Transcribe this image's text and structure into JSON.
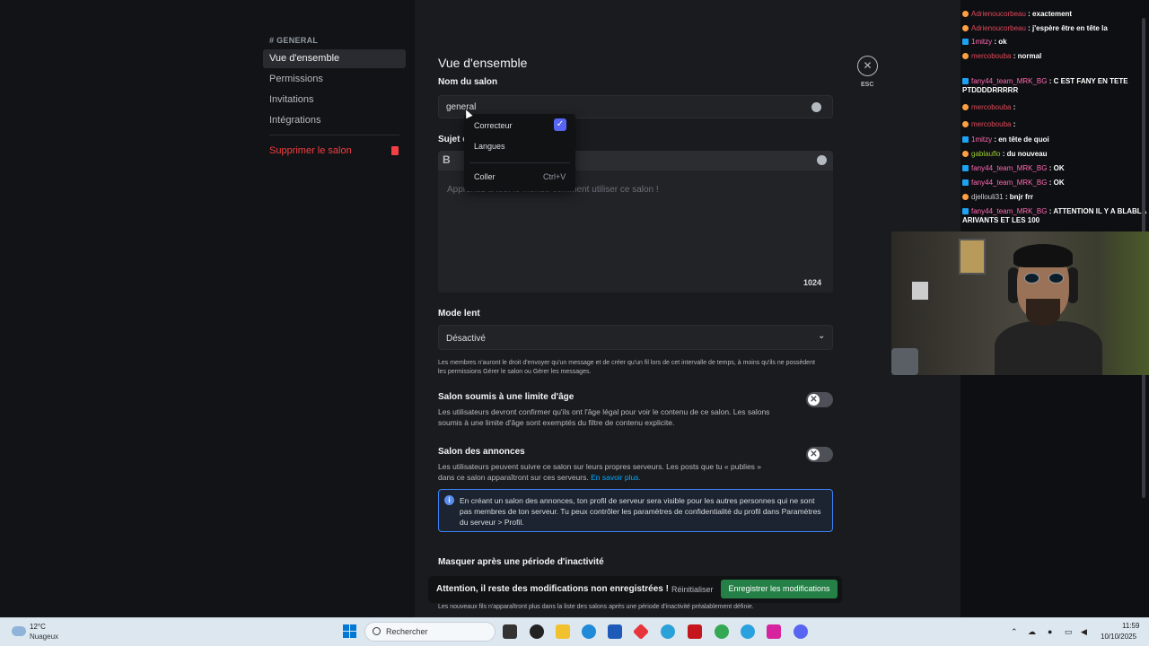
{
  "sidebar": {
    "category": "# GENERAL",
    "items": [
      {
        "label": "Vue d'ensemble"
      },
      {
        "label": "Permissions"
      },
      {
        "label": "Invitations"
      },
      {
        "label": "Intégrations"
      }
    ],
    "delete_label": "Supprimer le salon"
  },
  "main": {
    "title": "Vue d'ensemble",
    "channel_name_label": "Nom du salon",
    "channel_name_value": "general",
    "topic_label": "Sujet d",
    "topic_placeholder": "Apprenez à tout le monde comment utiliser ce salon !",
    "topic_counter": "1024",
    "slowmode_label": "Mode lent",
    "slowmode_value": "Désactivé",
    "slowmode_help": "Les membres n'auront le droit d'envoyer qu'un message et de créer qu'un fil lors de cet intervalle de temps, à moins qu'ils ne possèdent les permissions Gérer le salon ou Gérer les messages.",
    "age_title": "Salon soumis à une limite d'âge",
    "age_desc": "Les utilisateurs devront confirmer qu'ils ont l'âge légal pour voir le contenu de ce salon. Les salons soumis à une limite d'âge sont exemptés du filtre de contenu explicite.",
    "announce_title": "Salon des annonces",
    "announce_desc": "Les utilisateurs peuvent suivre ce salon sur leurs propres serveurs. Les posts que tu « publies » dans ce salon apparaîtront sur ces serveurs.",
    "announce_link": "En savoir plus.",
    "info_text": "En créant un salon des annonces, ton profil de serveur sera visible pour les autres personnes qui ne sont pas membres de ton serveur. Tu peux contrôler les paramètres de confidentialité du profil dans Paramètres du serveur > Profil.",
    "inactivity_title": "Masquer après une période d'inactivité",
    "footer_help": "Les nouveaux fils n'apparaîtront plus dans la liste des salons après une période d'inactivité préalablement définie.",
    "close_label": "ESC"
  },
  "context_menu": {
    "items": [
      "Correcteur",
      "Langues",
      "Coller"
    ],
    "paste_shortcut": "Ctrl+V"
  },
  "notice": {
    "text": "Attention, il reste des modifications non enregistrées !",
    "reset": "Réinitialiser",
    "save": "Enregistrer les modifications"
  },
  "chat": [
    {
      "user": "Adrienoucorbeau",
      "msg": ": exactement",
      "ucls": "u-red"
    },
    {
      "user": "Adrienoucorbeau",
      "msg": ": j'espère être en tête la",
      "ucls": "u-red"
    },
    {
      "user": "1mitzy",
      "msg": ": ok",
      "ucls": "u-pink"
    },
    {
      "user": "mercobouba",
      "msg": ": normal",
      "ucls": "u-red"
    },
    {
      "user": "fany44_team_MRK_BG",
      "msg": ": C EST FANY EN TETE PTDDDDRRRRR",
      "ucls": "u-pink"
    },
    {
      "user": "mercobouba",
      "msg": ":",
      "ucls": "u-red"
    },
    {
      "user": "mercobouba",
      "msg": ":",
      "ucls": "u-red"
    },
    {
      "user": "1mitzy",
      "msg": ": en tête de quoi",
      "ucls": "u-pink"
    },
    {
      "user": "gablauflo",
      "msg": ": du nouveau",
      "ucls": "u-green"
    },
    {
      "user": "fany44_team_MRK_BG",
      "msg": ": OK",
      "ucls": "u-pink"
    },
    {
      "user": "fany44_team_MRK_BG",
      "msg": ": OK",
      "ucls": "u-pink"
    },
    {
      "user": "djellouli31",
      "msg": ": bnjr frr",
      "ucls": "u-grey"
    },
    {
      "user": "fany44_team_MRK_BG",
      "msg": ": ATTENTION IL Y A BLABLA ARIVANTS ET LES 100",
      "ucls": "u-pink"
    }
  ],
  "taskbar": {
    "temp": "12°C",
    "weather": "Nuageux",
    "search": "Rechercher",
    "time": "11:59",
    "date": "10/10/2025"
  }
}
